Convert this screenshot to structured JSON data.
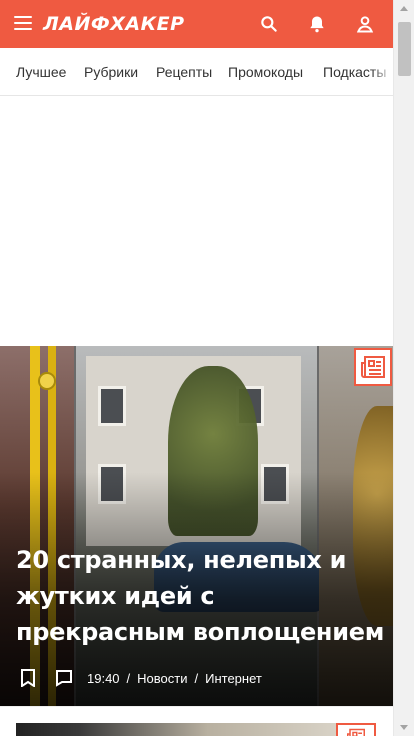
{
  "header": {
    "logo": "ЛАЙФХАКЕР",
    "menu_icon": "hamburger-menu-icon",
    "search_icon": "search-icon",
    "notifications_icon": "bell-icon",
    "profile_icon": "user-icon",
    "accent_color": "#ef5a41"
  },
  "nav": {
    "items": [
      {
        "label": "Лучшее"
      },
      {
        "label": "Рубрики"
      },
      {
        "label": "Рецепты"
      },
      {
        "label": "Промокоды"
      },
      {
        "label": "Подкасты"
      }
    ]
  },
  "featured": {
    "title": "20 странных, нелепых и жутких идей с прекрасным воплощением",
    "type_icon": "article-icon",
    "bookmark_icon": "bookmark-icon",
    "comments_icon": "comment-icon",
    "time": "19:40",
    "separator": "/",
    "category": "Новости",
    "tag": "Интернет"
  },
  "next_card": {
    "type_icon": "article-icon"
  }
}
